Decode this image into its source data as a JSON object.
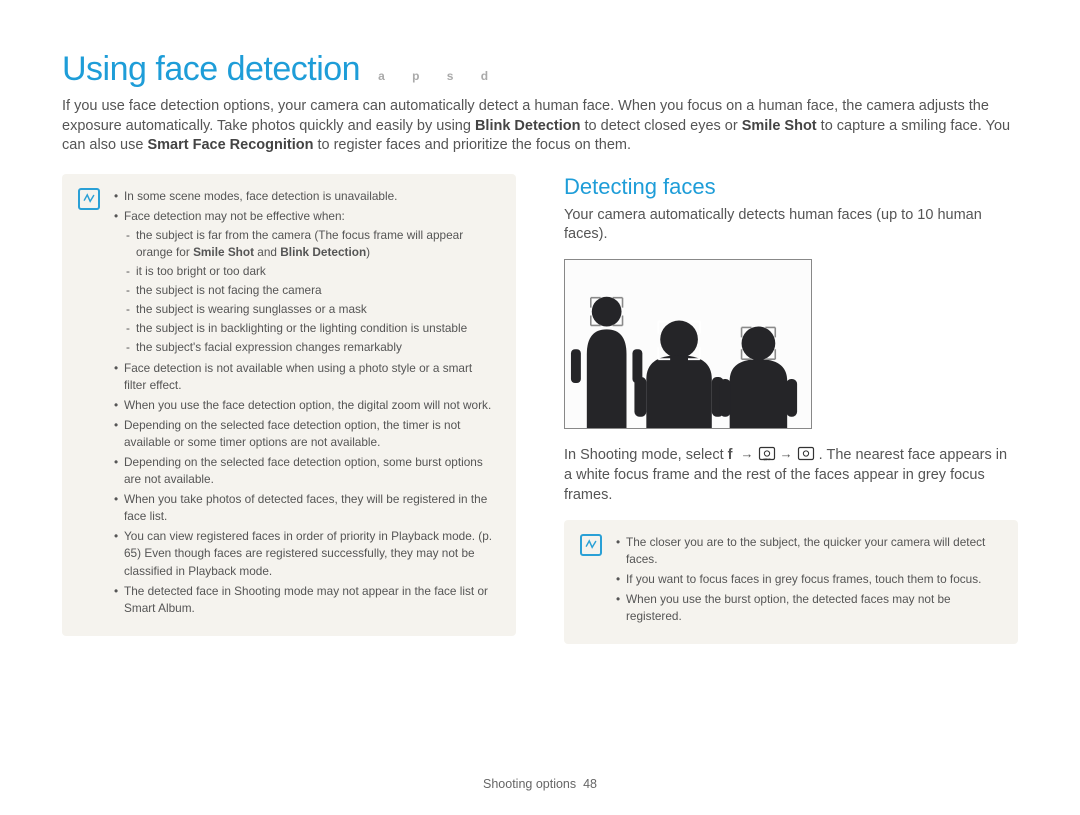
{
  "title": "Using face detection",
  "modeLetters": "a p s d",
  "intro_parts": [
    "If you use face detection options, your camera can automatically detect a human face. When you focus on a human face, the camera adjusts the exposure automatically. Take photos quickly and easily by using ",
    "Blink Detection",
    " to detect closed eyes or ",
    "Smile Shot",
    " to capture a smiling face. You can also use ",
    "Smart Face Recognition",
    " to register faces and prioritize the focus on them."
  ],
  "leftNotes": {
    "items": [
      {
        "text": "In some scene modes, face detection is unavailable."
      },
      {
        "text": "Face detection may not be effective when:",
        "sub": [
          {
            "pre": "the subject is far from the camera (The focus frame will appear orange for ",
            "b1": "Smile Shot",
            "mid": " and ",
            "b2": "Blink Detection",
            "post": ")"
          },
          {
            "pre": "it is too bright or too dark"
          },
          {
            "pre": "the subject is not facing the camera"
          },
          {
            "pre": "the subject is wearing sunglasses or a mask"
          },
          {
            "pre": "the subject is in backlighting or the lighting condition is unstable"
          },
          {
            "pre": "the subject's facial expression changes remarkably"
          }
        ]
      },
      {
        "text": "Face detection is not available when using a photo style or a smart filter effect."
      },
      {
        "text": "When you use the face detection option, the digital zoom will not work."
      },
      {
        "text": "Depending on the selected face detection option, the timer is not available or some timer options are not available."
      },
      {
        "text": "Depending on the selected face detection option, some burst options are not available."
      },
      {
        "text": "When you take photos of detected faces, they will be registered in the face list."
      },
      {
        "text": "You can view registered faces in order of priority in Playback mode. (p. 65) Even though faces are registered successfully, they may not be classified in Playback mode."
      },
      {
        "text": "The detected face in Shooting mode may not appear in the face list or Smart Album."
      }
    ]
  },
  "right": {
    "heading": "Detecting faces",
    "lead": "Your camera automatically detects human faces (up to 10 human faces).",
    "shoot_pre": "In Shooting mode, select ",
    "shoot_f": "f",
    "shoot_post": ". The nearest face appears in a white focus frame and the rest of the faces appear in grey focus frames.",
    "notes": [
      "The closer you are to the subject, the quicker your camera will detect faces.",
      "If you want to focus faces in grey focus frames, touch them to focus.",
      "When you use the burst option, the detected faces may not be registered."
    ]
  },
  "footer": {
    "label": "Shooting options",
    "page": "48"
  }
}
